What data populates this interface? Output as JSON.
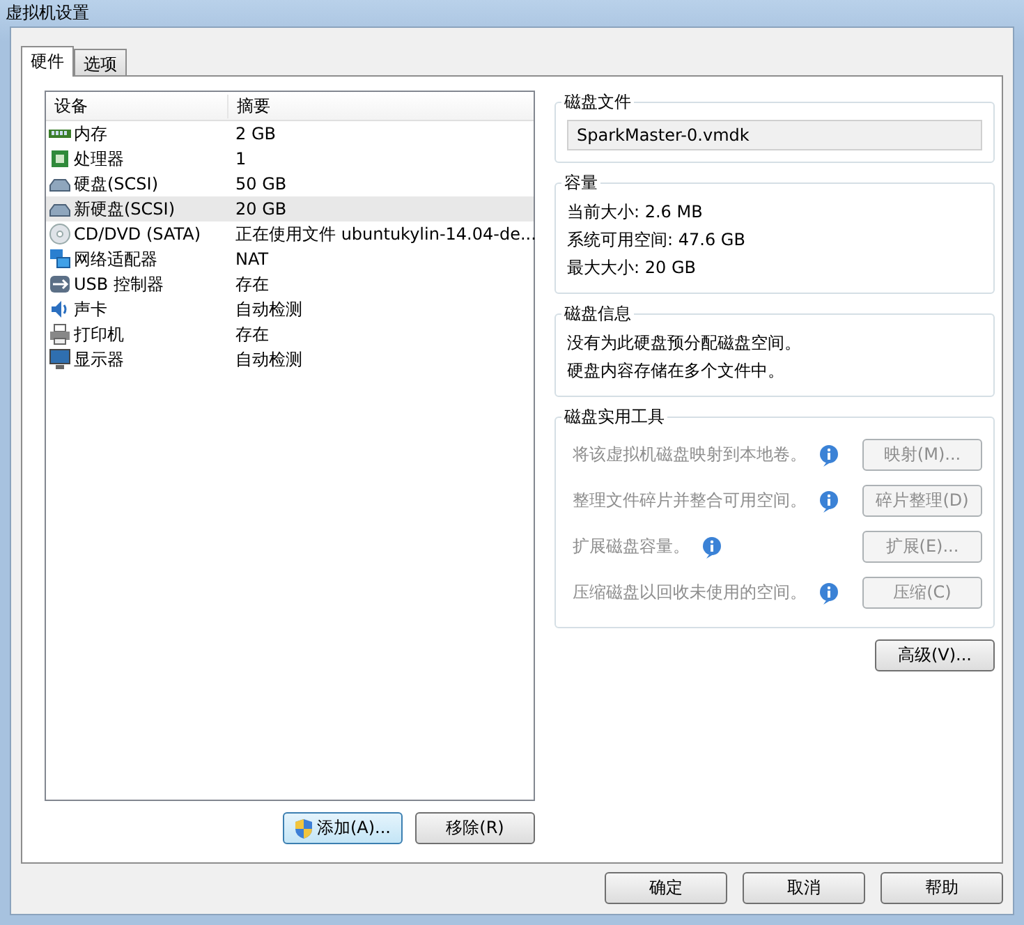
{
  "window": {
    "title": "虚拟机设置"
  },
  "tabs": [
    {
      "label": "硬件",
      "selected": true
    },
    {
      "label": "选项",
      "selected": false
    }
  ],
  "device_table": {
    "columns": [
      "设备",
      "摘要"
    ],
    "rows": [
      {
        "kind": "memory",
        "device": "内存",
        "summary": "2 GB",
        "selected": false
      },
      {
        "kind": "cpu",
        "device": "处理器",
        "summary": "1",
        "selected": false
      },
      {
        "kind": "disk",
        "device": "硬盘(SCSI)",
        "summary": "50 GB",
        "selected": false
      },
      {
        "kind": "disk",
        "device": "新硬盘(SCSI)",
        "summary": "20 GB",
        "selected": true
      },
      {
        "kind": "cd",
        "device": "CD/DVD (SATA)",
        "summary": "正在使用文件 ubuntukylin-14.04-de...",
        "selected": false
      },
      {
        "kind": "network",
        "device": "网络适配器",
        "summary": "NAT",
        "selected": false
      },
      {
        "kind": "usb",
        "device": "USB 控制器",
        "summary": "存在",
        "selected": false
      },
      {
        "kind": "sound",
        "device": "声卡",
        "summary": "自动检测",
        "selected": false
      },
      {
        "kind": "printer",
        "device": "打印机",
        "summary": "存在",
        "selected": false
      },
      {
        "kind": "display",
        "device": "显示器",
        "summary": "自动检测",
        "selected": false
      }
    ]
  },
  "list_buttons": [
    {
      "label": "添加(A)...",
      "shield": true
    },
    {
      "label": "移除(R)",
      "shield": false
    }
  ],
  "disk_file": {
    "title": "磁盘文件",
    "value": "SparkMaster-0.vmdk"
  },
  "capacity": {
    "title": "容量",
    "lines": [
      "当前大小: 2.6 MB",
      "系统可用空间: 47.6 GB",
      "最大大小: 20 GB"
    ]
  },
  "disk_info": {
    "title": "磁盘信息",
    "lines": [
      "没有为此硬盘预分配磁盘空间。",
      "硬盘内容存储在多个文件中。"
    ]
  },
  "disk_utilities": {
    "title": "磁盘实用工具",
    "items": [
      {
        "text": "将该虚拟机磁盘映射到本地卷。",
        "button": "映射(M)...",
        "disabled": true
      },
      {
        "text": "整理文件碎片并整合可用空间。",
        "button": "碎片整理(D)",
        "disabled": true
      },
      {
        "text": "扩展磁盘容量。",
        "button": "扩展(E)...",
        "disabled": true
      },
      {
        "text": "压缩磁盘以回收未使用的空间。",
        "button": "压缩(C)",
        "disabled": true
      }
    ]
  },
  "advanced_button": "高级(V)...",
  "footer_buttons": [
    "确定",
    "取消",
    "帮助"
  ]
}
